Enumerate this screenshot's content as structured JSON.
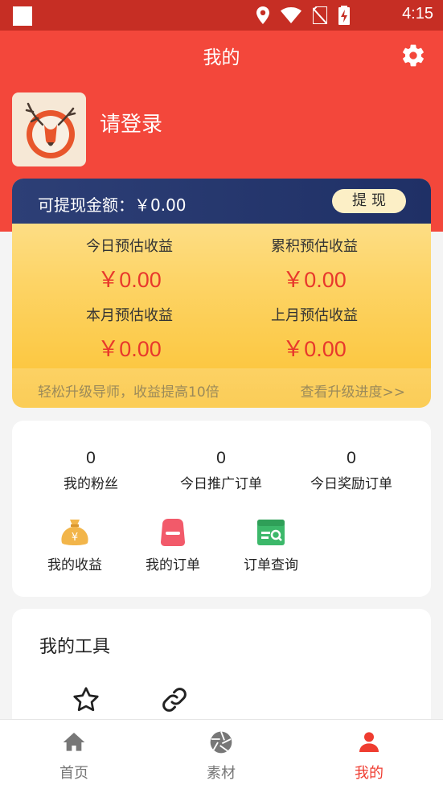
{
  "status_bar": {
    "time": "4:15"
  },
  "header": {
    "title": "我的"
  },
  "profile": {
    "login_text": "请登录"
  },
  "earnings": {
    "withdraw_label": "可提现金额：￥0.00",
    "withdraw_button": "提现",
    "stats": [
      {
        "label": "今日预估收益",
        "value": "￥0.00"
      },
      {
        "label": "累积预估收益",
        "value": "￥0.00"
      },
      {
        "label": "本月预估收益",
        "value": "￥0.00"
      },
      {
        "label": "上月预估收益",
        "value": "￥0.00"
      }
    ],
    "upgrade_text": "轻松升级导师，收益提高10倍",
    "progress_link": "查看升级进度>>"
  },
  "counters": [
    {
      "value": "0",
      "label": "我的粉丝"
    },
    {
      "value": "0",
      "label": "今日推广订单"
    },
    {
      "value": "0",
      "label": "今日奖励订单"
    }
  ],
  "functions": [
    {
      "label": "我的收益",
      "icon": "money-bag-icon"
    },
    {
      "label": "我的订单",
      "icon": "order-box-icon"
    },
    {
      "label": "订单查询",
      "icon": "order-search-icon"
    }
  ],
  "tools": {
    "title": "我的工具",
    "items": [
      {
        "icon": "star-icon"
      },
      {
        "icon": "link-icon"
      }
    ]
  },
  "tabbar": [
    {
      "label": "首页",
      "icon": "home-icon",
      "active": false
    },
    {
      "label": "素材",
      "icon": "aperture-icon",
      "active": false
    },
    {
      "label": "我的",
      "icon": "person-icon",
      "active": true
    }
  ],
  "colors": {
    "primary_red": "#f3473b",
    "status_red": "#c62e24",
    "amount_red": "#e8382c",
    "card_navy": "#243568",
    "card_gold": "#fdd466"
  }
}
